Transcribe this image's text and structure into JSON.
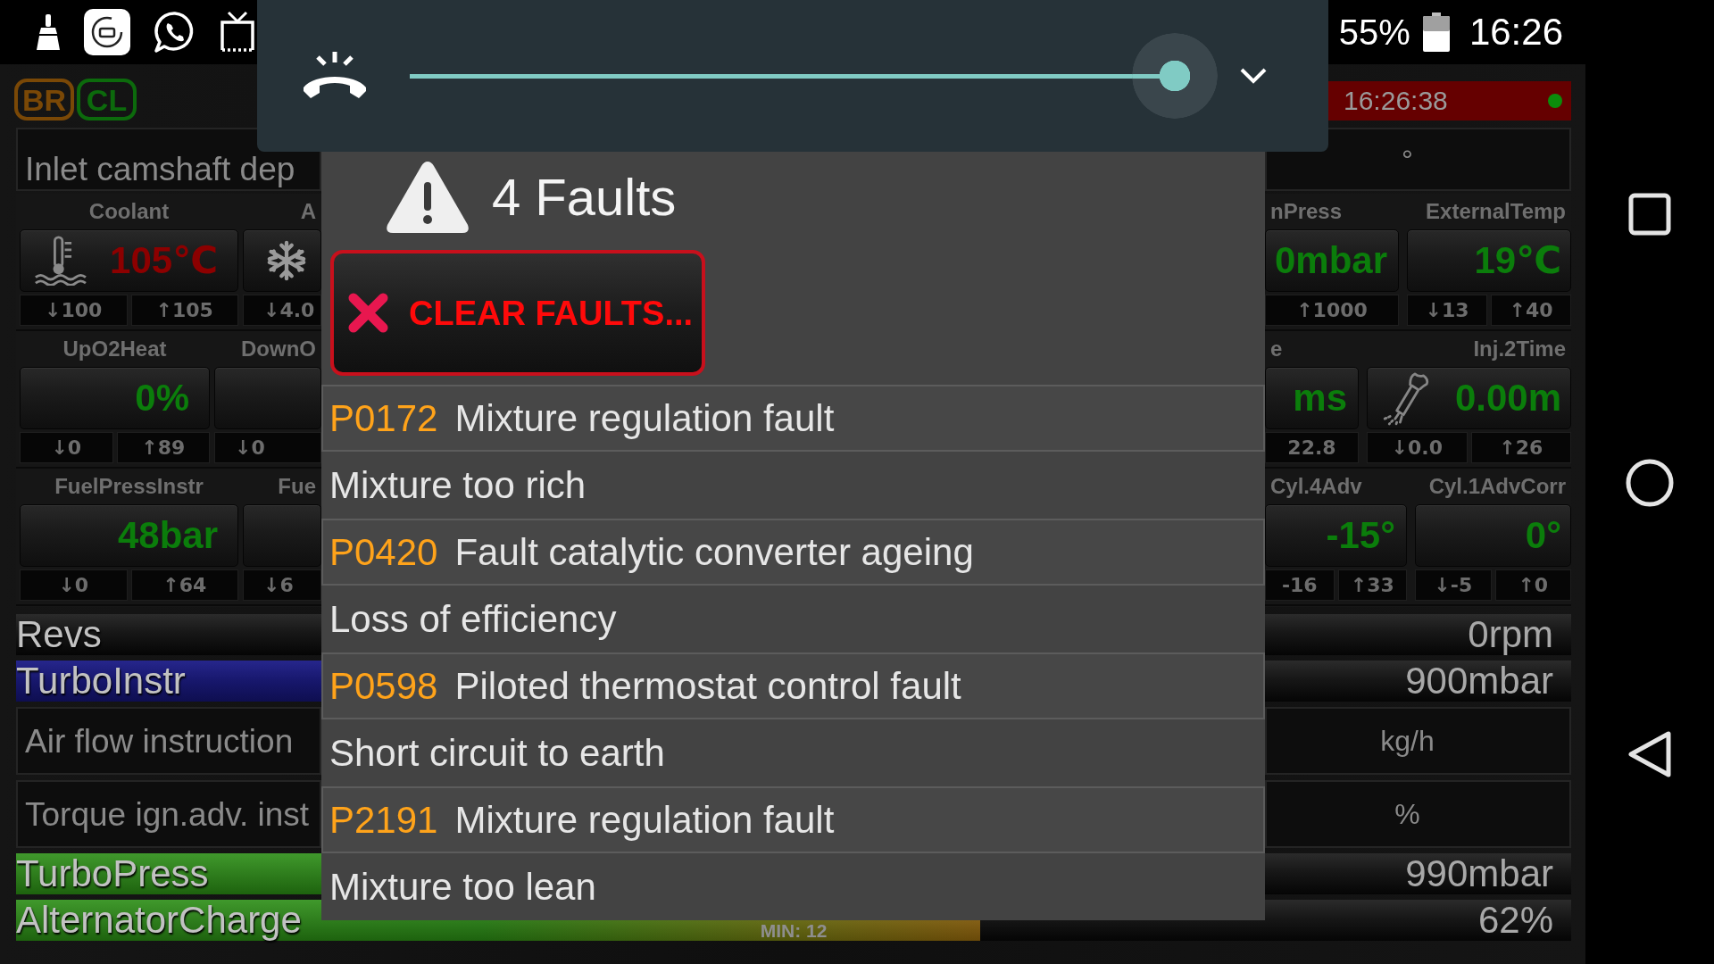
{
  "status_bar": {
    "battery": "55%",
    "time": "16:26"
  },
  "volume_panel": {
    "level": 1
  },
  "fault_dialog": {
    "title": "4 Faults",
    "clear_button": "CLEAR FAULTS...",
    "faults": [
      {
        "code": "P0172",
        "name": "Mixture regulation fault",
        "detail": "Mixture too rich"
      },
      {
        "code": "P0420",
        "name": "Fault catalytic converter ageing",
        "detail": "Loss of efficiency"
      },
      {
        "code": "P0598",
        "name": "Piloted thermostat control fault",
        "detail": "Short circuit to earth"
      },
      {
        "code": "P2191",
        "name": "Mixture regulation fault",
        "detail": "Mixture too lean"
      }
    ]
  },
  "dashboard": {
    "badges": [
      {
        "label": "BR",
        "color": "#7a4806"
      },
      {
        "label": "CL",
        "color": "#0c6a0c"
      }
    ],
    "clock": "16:26:38",
    "top_field": {
      "text": "Inlet camshaft dep",
      "unit": "°"
    },
    "left_gauges": [
      [
        {
          "label": "Coolant",
          "kind": "coolant",
          "value": "105℃",
          "alarm": true,
          "stats": [
            "↓100",
            "↑105"
          ]
        },
        {
          "label": "A",
          "kind": "aircon",
          "stats": [
            "↓4.0"
          ]
        }
      ],
      [
        {
          "label": "UpO2Heat",
          "kind": "plain",
          "value": "0%",
          "alarm": false,
          "stats": [
            "↓0",
            "↑89"
          ]
        },
        {
          "label": "DownO",
          "kind": "plain",
          "stats": [
            "↓0"
          ]
        }
      ],
      [
        {
          "label": "FuelPressInstr",
          "kind": "plain",
          "value": "48bar",
          "alarm": false,
          "stats": [
            "↓0",
            "↑64"
          ]
        },
        {
          "label": "Fue",
          "kind": "plain",
          "stats": [
            "↓6"
          ]
        }
      ]
    ],
    "right_gauges": [
      [
        {
          "label": "nPress",
          "kind": "plain",
          "value": "0mbar",
          "alarm": false,
          "stats": [
            "↑1000"
          ]
        },
        {
          "label": "ExternalTemp",
          "kind": "plain",
          "value": "19℃",
          "alarm": false,
          "stats": [
            "↓13",
            "↑40"
          ]
        }
      ],
      [
        {
          "label": "e",
          "kind": "plain",
          "value": "ms",
          "alarm": false,
          "stats": [
            "22.8"
          ]
        },
        {
          "label": "Inj.2Time",
          "kind": "injector",
          "value": "0.00m",
          "alarm": false,
          "stats": [
            "↓0.0",
            "↑26"
          ]
        }
      ],
      [
        {
          "label": "Cyl.4Adv",
          "kind": "plain",
          "value": "-15°",
          "alarm": false,
          "stats": [
            "-16",
            "↑33"
          ]
        },
        {
          "label": "Cyl.1AdvCorr",
          "kind": "plain",
          "value": "0°",
          "alarm": false,
          "stats": [
            "↓-5",
            "↑0"
          ]
        }
      ]
    ],
    "rows": [
      {
        "kind": "meter",
        "label": "Revs",
        "value": "0rpm"
      },
      {
        "kind": "setpoint",
        "label": "TurboInstr",
        "value": "900mbar",
        "level": 0.4
      },
      {
        "kind": "field",
        "text": "Air flow instruction",
        "unit": "kg/h"
      },
      {
        "kind": "field",
        "text": "Torque ign.adv. inst",
        "unit": "%"
      },
      {
        "kind": "meter",
        "label": "TurboPress",
        "value": "990mbar",
        "level": 0.4
      },
      {
        "kind": "meter",
        "label": "AlternatorCharge",
        "value": "62%",
        "level": 0.62,
        "min_label": "MIN: 12"
      }
    ]
  }
}
